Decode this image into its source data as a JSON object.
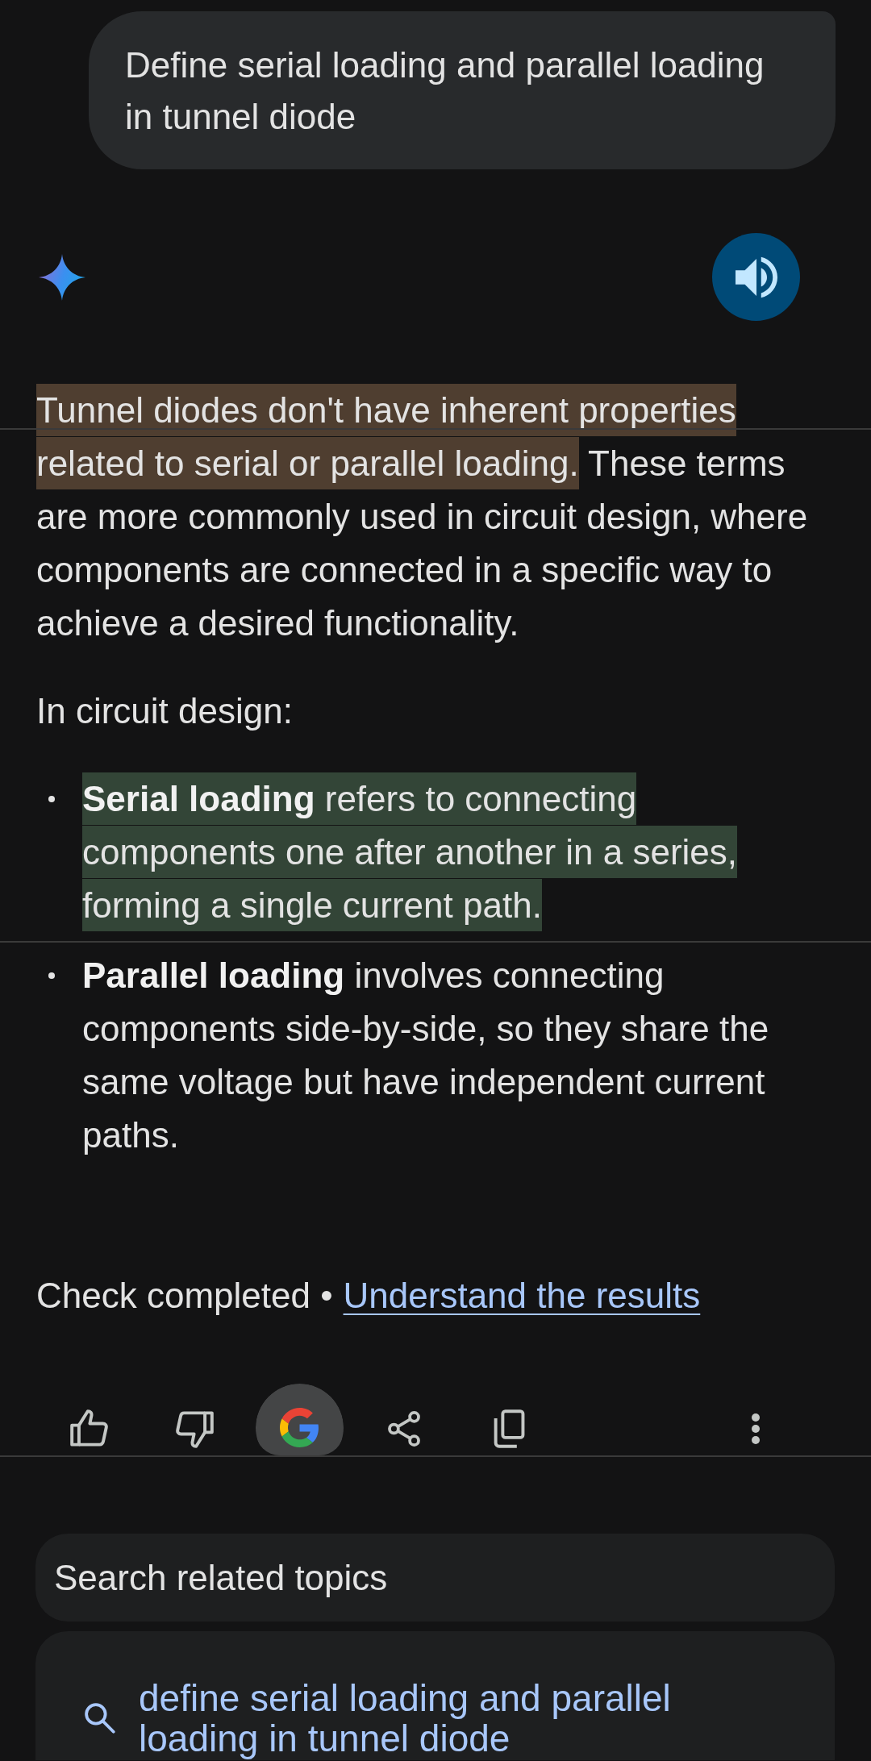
{
  "user_message": {
    "text": "Define serial loading and parallel loading in tunnel diode"
  },
  "response": {
    "actions": [
      {
        "kind": "speaker"
      }
    ],
    "blocks": [
      {
        "kind": "paragraph",
        "segments": [
          {
            "text": "Tunnel diodes don't have inherent properties related to serial or parallel loading.",
            "color": "#4f3e30"
          },
          {
            "text": "These terms are more commonly used in circuit design, where components are connected in a specific way to achieve a desired functionality."
          }
        ]
      },
      {
        "kind": "paragraph",
        "segments": [
          {
            "text": "In circuit design:"
          }
        ]
      },
      {
        "kind": "bullets",
        "items": [
          {
            "text": "**Serial loading** refers to connecting components one after another in a series, forming a single current path.",
            "color": "#334537"
          },
          {
            "text": "**Parallel loading** involves connecting components side-by-side, so they share the same voltage but have independent current paths."
          }
        ]
      }
    ],
    "check": {
      "status": "Check completed •",
      "link": "Understand the results"
    }
  },
  "toolbar": [
    {
      "kind": "thumbs_up"
    },
    {
      "kind": "thumbs_down"
    },
    {
      "kind": "google"
    },
    {
      "kind": "share"
    },
    {
      "kind": "copy"
    },
    {
      "kind": "more"
    }
  ],
  "related": {
    "title": "Search related topics",
    "items": [
      {
        "text": "define serial loading and parallel loading in tunnel diode"
      }
    ]
  }
}
